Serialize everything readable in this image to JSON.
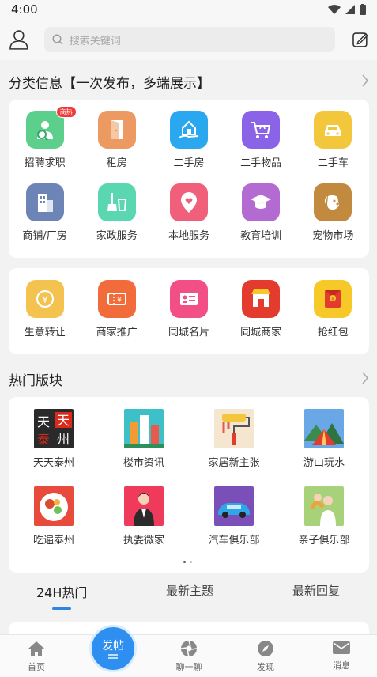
{
  "status": {
    "time": "4:00"
  },
  "header": {
    "search_placeholder": "搜索关键词"
  },
  "category_section": {
    "title": "分类信息【一次发布，多端展示】"
  },
  "categories_row1": [
    {
      "label": "招聘求职",
      "icon": "job-icon",
      "badge": "商热",
      "color": "#5ccf8c"
    },
    {
      "label": "租房",
      "icon": "door-icon",
      "color": "#ec9a62"
    },
    {
      "label": "二手房",
      "icon": "house-hand-icon",
      "color": "#29a7ef"
    },
    {
      "label": "二手物品",
      "icon": "cart-icon",
      "color": "#8a63e6"
    },
    {
      "label": "二手车",
      "icon": "car-icon",
      "color": "#f2c73b"
    }
  ],
  "categories_row2": [
    {
      "label": "商铺/厂房",
      "icon": "building-icon",
      "color": "#6c84b6"
    },
    {
      "label": "家政服务",
      "icon": "cleaning-icon",
      "color": "#5ad6b1"
    },
    {
      "label": "本地服务",
      "icon": "location-heart-icon",
      "color": "#f0607a"
    },
    {
      "label": "教育培训",
      "icon": "graduation-cap-icon",
      "color": "#b36bd2"
    },
    {
      "label": "宠物市场",
      "icon": "dog-icon",
      "color": "#c18a3e"
    }
  ],
  "services": [
    {
      "label": "生意转让",
      "icon": "yen-exchange-icon",
      "color": "#f4c24e"
    },
    {
      "label": "商家推广",
      "icon": "coupon-icon",
      "color": "#f26b3b"
    },
    {
      "label": "同城名片",
      "icon": "card-icon",
      "color": "#f24f86"
    },
    {
      "label": "同城商家",
      "icon": "shop-icon",
      "color": "#e33b2e"
    },
    {
      "label": "抢红包",
      "icon": "red-envelope-icon",
      "color": "#f7c928"
    }
  ],
  "hot_section": {
    "title": "热门版块"
  },
  "hot_row1": [
    {
      "label": "天天泰州",
      "icon": "tiantian-taizhou-logo",
      "logo_text": "天天泰州"
    },
    {
      "label": "楼市资讯",
      "icon": "buildings-icon"
    },
    {
      "label": "家居新主张",
      "icon": "paint-roller-icon"
    },
    {
      "label": "游山玩水",
      "icon": "tent-icon"
    }
  ],
  "hot_row2": [
    {
      "label": "吃遍泰州",
      "icon": "food-icon"
    },
    {
      "label": "执委微家",
      "icon": "businesswoman-icon"
    },
    {
      "label": "汽车俱乐部",
      "icon": "sports-car-icon"
    },
    {
      "label": "亲子俱乐部",
      "icon": "parent-child-icon"
    }
  ],
  "tabs": [
    "24H热门",
    "最新主题",
    "最新回复"
  ],
  "bottom_nav": {
    "home": "首页",
    "post": "发帖",
    "chat": "聊一聊",
    "discover": "发现",
    "messages": "消息"
  },
  "colors": {
    "accent": "#2e8ff0",
    "badge": "#f03a3a"
  }
}
